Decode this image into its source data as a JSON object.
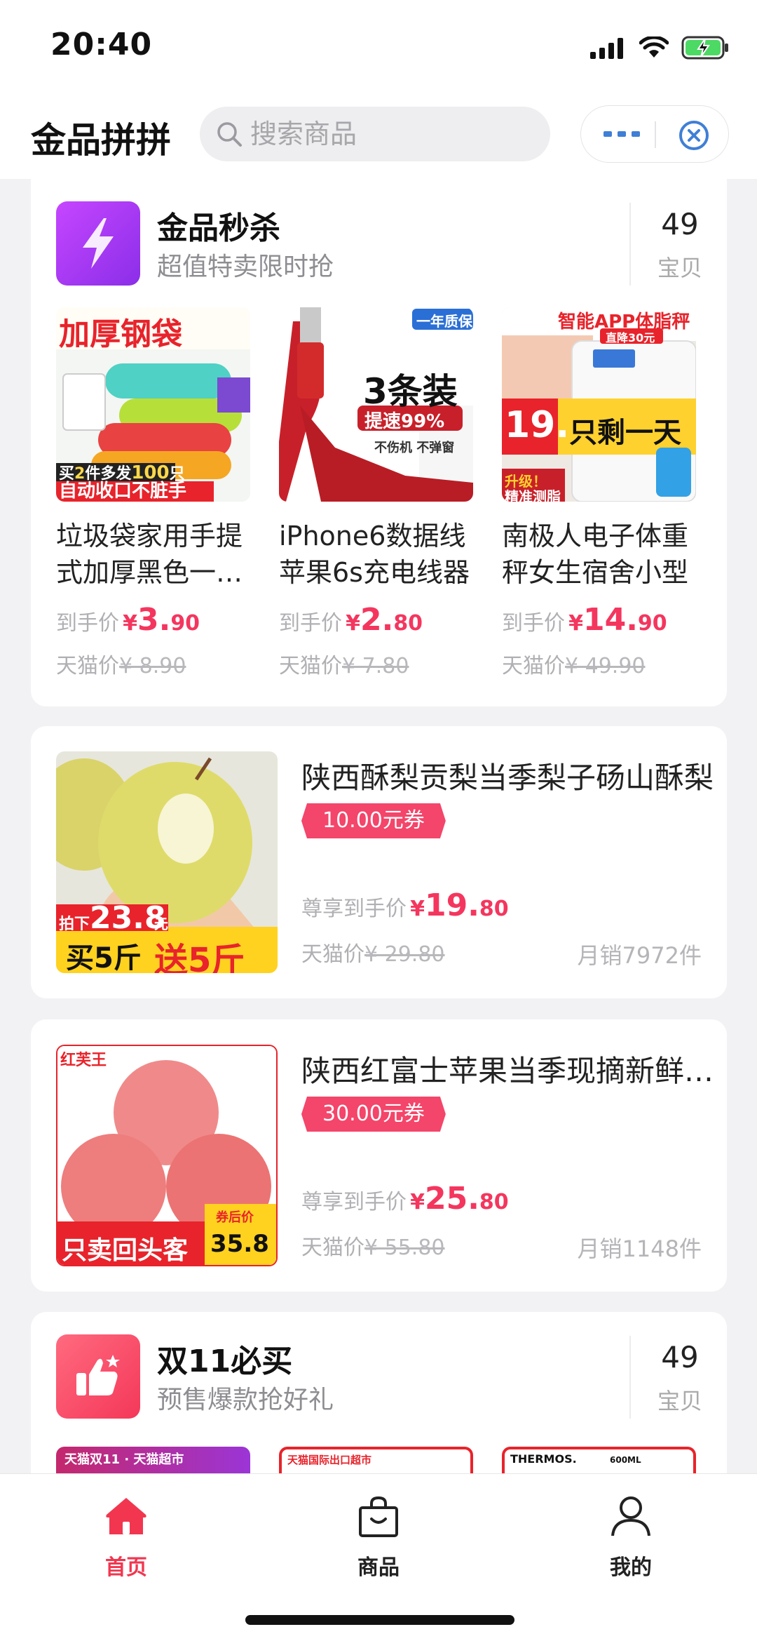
{
  "status_bar": {
    "time": "20:40",
    "icons": [
      "signal-icon",
      "wifi-icon",
      "battery-charging-icon"
    ]
  },
  "header": {
    "title": "金品拼拼",
    "search": {
      "placeholder": "搜索商品",
      "icon": "search-icon"
    },
    "capsule": {
      "more_icon": "more-dots-icon",
      "close_icon": "close-miniapp-icon"
    }
  },
  "flash_sale": {
    "icon": "lightning-icon",
    "title": "金品秒杀",
    "subtitle": "超值特卖限时抢",
    "count": "49",
    "count_label": "宝贝",
    "items": [
      {
        "name": "垃圾袋家用手提式加厚黑色一次性",
        "price_label": "到手价",
        "currency": "¥",
        "price_int": "3.",
        "price_dec": "90",
        "orig_label": "天猫价",
        "orig_price": "¥ 8.90",
        "image": {
          "top_text": "加厚钢袋",
          "badge1_a": "买",
          "badge1_b": "2",
          "badge1_c": "件多发",
          "badge1_d": "100",
          "badge1_e": "只",
          "badge2": "自动收口不脏手"
        }
      },
      {
        "name": "iPhone6数据线苹果6s充电线器",
        "price_label": "到手价",
        "currency": "¥",
        "price_int": "2.",
        "price_dec": "80",
        "orig_label": "天猫价",
        "orig_price": "¥ 7.80",
        "image": {
          "tag": "一年质保",
          "big": "3条装",
          "speed": "提速99%",
          "small": "不伤机 不弹窗"
        }
      },
      {
        "name": "南极人电子体重秤女生宿舍小型",
        "price_label": "到手价",
        "currency": "¥",
        "price_int": "14.",
        "price_dec": "90",
        "orig_label": "天猫价",
        "orig_price": "¥ 49.90",
        "image": {
          "top": "智能APP体脂秤",
          "drop": "直降30元",
          "price": "19.",
          "left": "只剩一天",
          "upgrade": "升级！",
          "measure": "精准测脂"
        }
      }
    ]
  },
  "products": [
    {
      "title": "陕西酥梨贡梨当季梨子砀山酥梨",
      "coupon": "10.00元券",
      "price_label": "尊享到手价",
      "currency": "¥",
      "price_int": "19.",
      "price_dec": "80",
      "orig_label": "天猫价",
      "orig_price": "¥ 29.80",
      "sales": "月销7972件",
      "image": {
        "pai": "拍下",
        "price": "23.8",
        "unit": "元",
        "buy": "买5斤",
        "send": "送5斤"
      }
    },
    {
      "title": "陕西红富士苹果当季现摘新鲜水果",
      "coupon": "30.00元券",
      "price_label": "尊享到手价",
      "currency": "¥",
      "price_int": "25.",
      "price_dec": "80",
      "orig_label": "天猫价",
      "orig_price": "¥ 55.80",
      "sales": "月销1148件",
      "image": {
        "brand": "红芙王",
        "after": "券后价",
        "price": "35.8",
        "slogan": "只卖回头客"
      }
    }
  ],
  "double11": {
    "icon": "thumbs-up-icon",
    "title": "双11必买",
    "subtitle": "预售爆款抢好礼",
    "count": "49",
    "count_label": "宝贝",
    "thumbs": [
      {
        "text": "天猫双11 · 天猫超市"
      },
      {
        "text": "天猫国际出口超市"
      },
      {
        "text": "THERMOS.",
        "sub": "600ML"
      }
    ]
  },
  "tab_bar": {
    "tabs": [
      {
        "label": "首页",
        "icon": "home-icon",
        "active": true
      },
      {
        "label": "商品",
        "icon": "shopping-bag-icon",
        "active": false
      },
      {
        "label": "我的",
        "icon": "user-icon",
        "active": false
      }
    ]
  },
  "colors": {
    "accent": "#f4365e",
    "coupon": "#f4456a",
    "tab_active": "#f2364f"
  }
}
